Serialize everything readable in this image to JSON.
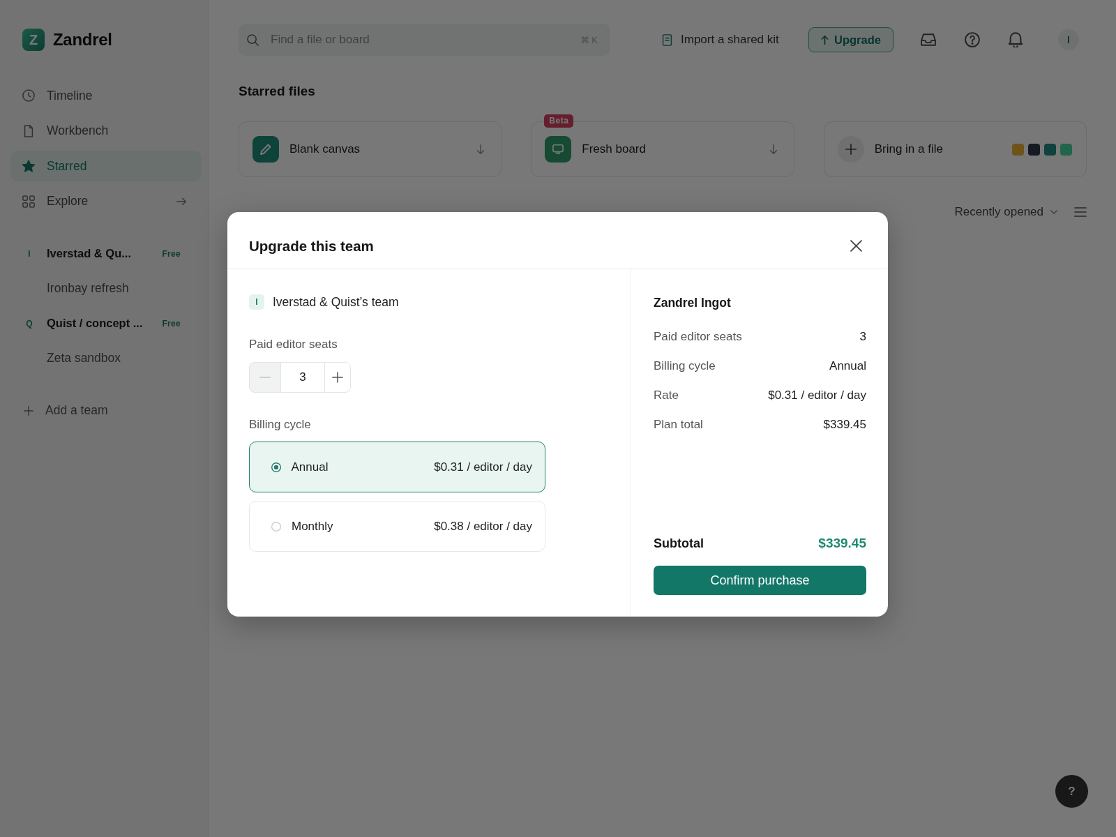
{
  "sidebar": {
    "brand": {
      "logo_letter": "Z",
      "name": "Zandrel"
    },
    "nav": [
      {
        "label": "Timeline",
        "selected": false
      },
      {
        "label": "Workbench",
        "selected": false
      },
      {
        "label": "Starred",
        "selected": true
      },
      {
        "label": "Explore",
        "selected": false
      }
    ],
    "teams": [
      {
        "initial": "I",
        "name": "Iverstad & Qu...",
        "plan": "Free",
        "children": [
          {
            "name": "Ironbay refresh"
          }
        ]
      },
      {
        "initial": "Q",
        "name": "Quist / concept ...",
        "plan": "Free",
        "children": [
          {
            "name": "Zeta sandbox"
          }
        ]
      }
    ],
    "add_team": "Add a team"
  },
  "topbar": {
    "search": {
      "placeholder": "Find a file or board",
      "shortcut": "⌘ K"
    },
    "import_link": "Import a shared kit",
    "upgrade_button": "Upgrade",
    "avatar": "I"
  },
  "starred": {
    "heading": "Starred files",
    "cards": [
      {
        "kind": "canvas",
        "title": "Blank canvas"
      },
      {
        "kind": "board",
        "title": "Fresh board",
        "badge": "Beta"
      },
      {
        "kind": "import",
        "title": "Bring in a file",
        "swatches": [
          {
            "color": "#6e5418"
          },
          {
            "color": "#161a22"
          },
          {
            "color": "#0f423c"
          },
          {
            "color": "#22654c"
          }
        ]
      }
    ]
  },
  "view_bar": {
    "sort": "Recently opened"
  },
  "modal": {
    "title": "Upgrade this team",
    "team": {
      "initial": "I",
      "name": "Iverstad & Quist’s team"
    },
    "seats": {
      "label": "Paid editor seats",
      "value": "3",
      "decrement": {
        "disabled": true
      },
      "increment": {
        "disabled": false
      }
    },
    "billing": {
      "label": "Billing cycle",
      "options": [
        {
          "label": "Annual",
          "price": "$0.31 / editor / day",
          "selected": true
        },
        {
          "label": "Monthly",
          "price": "$0.38 / editor / day",
          "selected": false
        }
      ]
    },
    "summary": {
      "title": "Zandrel Ingot",
      "rows": [
        {
          "label": "Paid editor seats",
          "value": "3"
        },
        {
          "label": "Billing cycle",
          "value": "Annual"
        },
        {
          "label": "Rate",
          "value": "$0.31 / editor / day"
        },
        {
          "label": "Plan total",
          "value": "$339.45"
        }
      ],
      "subtotal": {
        "label": "Subtotal",
        "value": "$339.45"
      },
      "confirm_button": "Confirm purchase"
    }
  },
  "help_button": "?"
}
